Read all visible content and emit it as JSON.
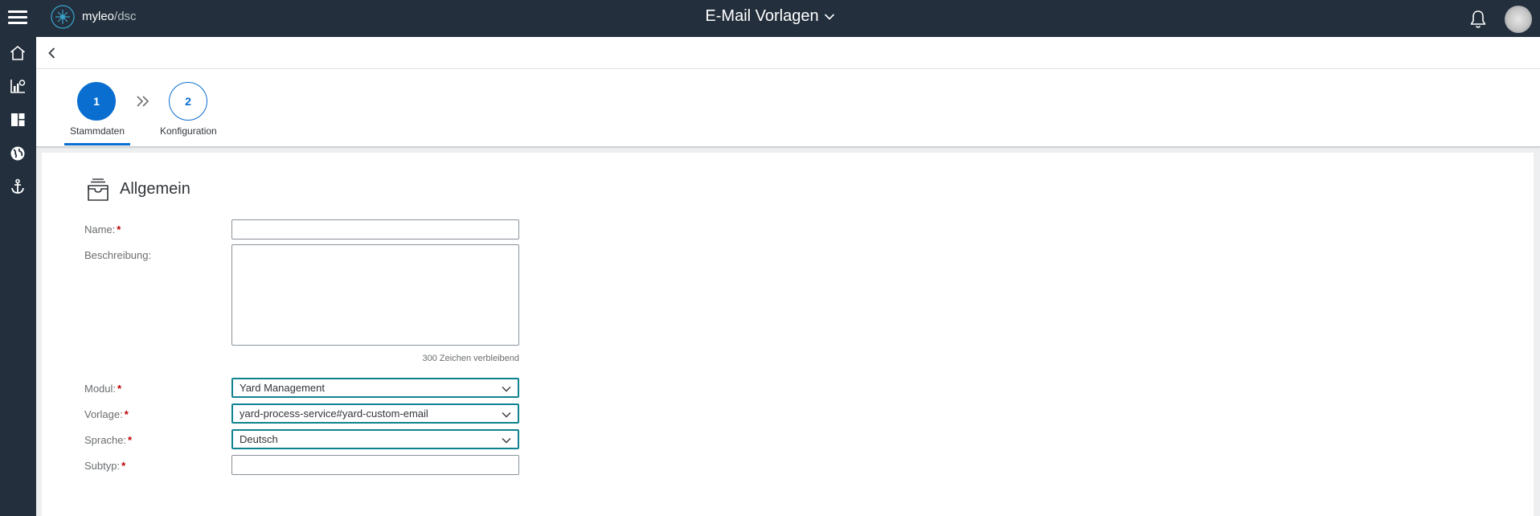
{
  "shell": {
    "brand_name": "myleo",
    "brand_sep": "/",
    "brand_sub": "dsc",
    "title": "E-Mail Vorlagen",
    "icons": {
      "menu": "hamburger-icon",
      "title_dropdown": "chevron-down-icon",
      "notifications": "bell-icon",
      "avatar": "user-avatar"
    }
  },
  "sidenav": {
    "items": [
      {
        "icon": "home-icon"
      },
      {
        "icon": "analytics-icon"
      },
      {
        "icon": "dashboard-icon"
      },
      {
        "icon": "globe-icon"
      },
      {
        "icon": "anchor-icon"
      }
    ]
  },
  "wizard": {
    "steps": [
      {
        "number": "1",
        "label": "Stammdaten",
        "active": true
      },
      {
        "number": "2",
        "label": "Konfiguration",
        "active": false
      }
    ]
  },
  "form": {
    "section_title": "Allgemein",
    "required_marker": "*",
    "name_label": "Name:",
    "name_value": "",
    "description_label": "Beschreibung:",
    "description_value": "",
    "char_count": "300 Zeichen verbleibend",
    "module_label": "Modul:",
    "module_value": "Yard Management",
    "template_label": "Vorlage:",
    "template_value": "yard-process-service#yard-custom-email",
    "language_label": "Sprache:",
    "language_value": "Deutsch",
    "subtype_label": "Subtyp:",
    "subtype_value": ""
  },
  "colors": {
    "shell_bg": "#232f3c",
    "accent": "#0a6ed1",
    "select_border": "#0f828f",
    "required": "#bb0000",
    "page_bg": "#edeff0"
  }
}
